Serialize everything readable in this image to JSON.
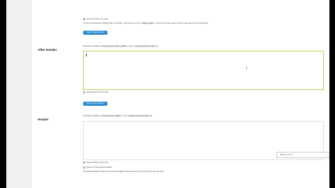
{
  "top_section": {
    "checkbox_label": "Remove Thesis nav footer",
    "description": "To show some blogroll / affiliate links in the footer, you'll need to use the",
    "code": "thesis_footer",
    "description_tail": "hook or the Footer section, which is also where the credit links go.",
    "button": "Save Thesis Options"
  },
  "after_header": {
    "label": "After Header",
    "help_prefix": "Equivalent to adding to",
    "hook_code": "thesis_hook_after_header",
    "help_mid": "in your",
    "file_code": "custom_functions.php",
    "help_suffix": "file.",
    "execute_php_label": "Execute PHP on this hook",
    "button": "Save Thesis Options"
  },
  "header": {
    "label": "Header",
    "help_prefix": "Equivalent to adding to",
    "hook_code": "thesis_hook_header",
    "help_mid": "in your",
    "file_code": "custom_functions.php",
    "help_suffix": "file.",
    "execute_php_label": "Execute PHP on this hook",
    "remove_default_label": "Remove Thesis default header",
    "remove_default_desc": "The default header includes the site title and tagline area generated by the Thesis logo and title tools."
  },
  "dropdown": {
    "value": "Select a hook"
  },
  "icons": {
    "gear": "gear-icon",
    "chevron": "chevron-down-icon",
    "text_cursor": "text-cursor-icon"
  }
}
